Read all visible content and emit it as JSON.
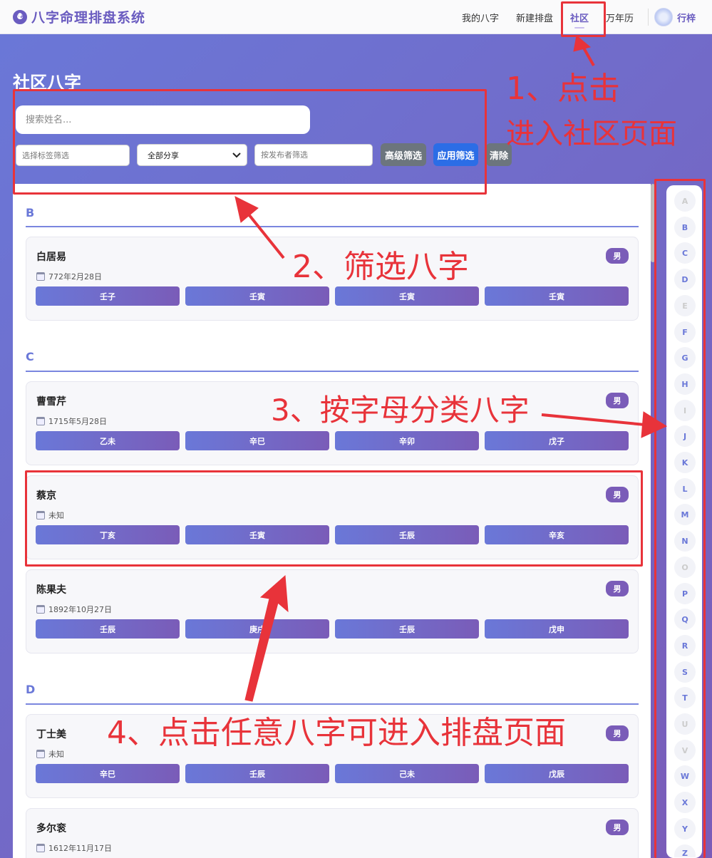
{
  "navbar": {
    "brand": "八字命理排盘系统",
    "links": [
      "我的八字",
      "新建排盘",
      "社区",
      "万年历"
    ],
    "user_name": "行梓"
  },
  "page": {
    "title": "社区八字",
    "search_placeholder": "搜索姓名...",
    "tag_filter_placeholder": "选择标签筛选",
    "share_select_value": "全部分享",
    "publisher_filter_placeholder": "按发布者筛选",
    "btn_advanced": "高级筛选",
    "btn_apply": "应用筛选",
    "btn_clear": "清除"
  },
  "sections": [
    {
      "letter": "B",
      "cards": [
        {
          "name": "白居易",
          "gender": "男",
          "date": "772年2月28日",
          "pillars": [
            "壬子",
            "壬寅",
            "壬寅",
            "壬寅"
          ]
        }
      ]
    },
    {
      "letter": "C",
      "cards": [
        {
          "name": "曹雪芹",
          "gender": "男",
          "date": "1715年5月28日",
          "pillars": [
            "乙未",
            "辛巳",
            "辛卯",
            "戊子"
          ]
        },
        {
          "name": "蔡京",
          "gender": "男",
          "date": "未知",
          "pillars": [
            "丁亥",
            "壬寅",
            "壬辰",
            "辛亥"
          ]
        },
        {
          "name": "陈果夫",
          "gender": "男",
          "date": "1892年10月27日",
          "pillars": [
            "壬辰",
            "庚戌",
            "壬辰",
            "戊申"
          ]
        }
      ]
    },
    {
      "letter": "D",
      "cards": [
        {
          "name": "丁士美",
          "gender": "男",
          "date": "未知",
          "pillars": [
            "辛巳",
            "壬辰",
            "己未",
            "戊辰"
          ]
        },
        {
          "name": "多尔衮",
          "gender": "男",
          "date": "1612年11月17日",
          "pillars": []
        }
      ]
    }
  ],
  "alphabet": [
    {
      "l": "A",
      "on": false
    },
    {
      "l": "B",
      "on": true
    },
    {
      "l": "C",
      "on": true
    },
    {
      "l": "D",
      "on": true
    },
    {
      "l": "E",
      "on": false
    },
    {
      "l": "F",
      "on": true
    },
    {
      "l": "G",
      "on": true
    },
    {
      "l": "H",
      "on": true
    },
    {
      "l": "I",
      "on": false
    },
    {
      "l": "J",
      "on": true
    },
    {
      "l": "K",
      "on": true
    },
    {
      "l": "L",
      "on": true
    },
    {
      "l": "M",
      "on": true
    },
    {
      "l": "N",
      "on": true
    },
    {
      "l": "O",
      "on": false
    },
    {
      "l": "P",
      "on": true
    },
    {
      "l": "Q",
      "on": true
    },
    {
      "l": "R",
      "on": true
    },
    {
      "l": "S",
      "on": true
    },
    {
      "l": "T",
      "on": true
    },
    {
      "l": "U",
      "on": false
    },
    {
      "l": "V",
      "on": false
    },
    {
      "l": "W",
      "on": true
    },
    {
      "l": "X",
      "on": true
    },
    {
      "l": "Y",
      "on": true
    },
    {
      "l": "Z",
      "on": true
    }
  ],
  "annotations": {
    "a1_line1": "1、点击",
    "a1_line2": "进入社区页面",
    "a2": "2、筛选八字",
    "a3": "3、按字母分类八字",
    "a4": "4、点击任意八字可进入排盘页面"
  },
  "colors": {
    "accent": "#6a5cc0",
    "annotation": "#e8333a",
    "pillar_start": "#6a78d8",
    "pillar_end": "#7a5cb8"
  }
}
